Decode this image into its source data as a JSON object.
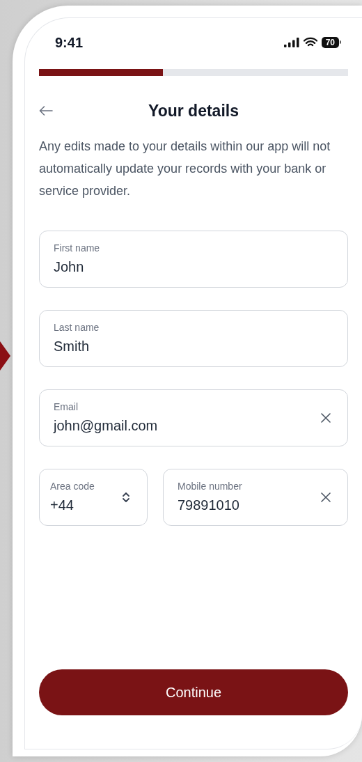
{
  "status_bar": {
    "time": "9:41",
    "battery": "70"
  },
  "progress": {
    "level": 0.4
  },
  "header": {
    "title": "Your details"
  },
  "notice": "Any edits made to your details within our app will not automatically update your records with your bank or service provider.",
  "fields": [
    {
      "label": "First name",
      "value": "John",
      "clearable": false
    },
    {
      "label": "Last name",
      "value": "Smith",
      "clearable": false
    },
    {
      "label": "Email",
      "value": "john@gmail.com",
      "clearable": true
    }
  ],
  "phone": {
    "area": {
      "label": "Area code",
      "value": "+44"
    },
    "number": {
      "label": "Mobile number",
      "value": "79891010",
      "clearable": true
    }
  },
  "primary_button": "Continue"
}
